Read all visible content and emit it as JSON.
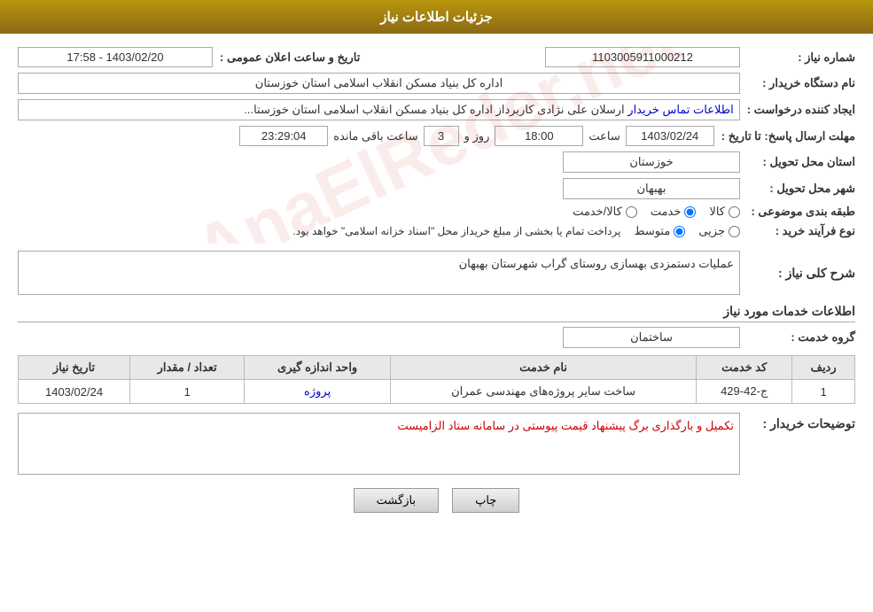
{
  "header": {
    "title": "جزئیات اطلاعات نیاز"
  },
  "fields": {
    "need_number_label": "شماره نیاز :",
    "need_number_value": "1103005911000212",
    "buyer_org_label": "نام دستگاه خریدار :",
    "buyer_org_value": "اداره کل بنیاد مسکن انقلاب اسلامی استان خوزستان",
    "creator_label": "ایجاد کننده درخواست :",
    "creator_value": "ارسلان علی نژادی کاربرداز اداره کل بنیاد مسکن انقلاب اسلامی استان خوزستا...",
    "creator_link": "اطلاعات تماس خریدار",
    "announce_date_label": "تاریخ و ساعت اعلان عمومی :",
    "announce_date_value": "1403/02/20 - 17:58",
    "response_deadline_label": "مهلت ارسال پاسخ: تا تاریخ :",
    "response_date": "1403/02/24",
    "response_time_label": "ساعت",
    "response_time": "18:00",
    "response_days_label": "روز و",
    "response_days": "3",
    "response_remaining_label": "ساعت باقی مانده",
    "response_remaining": "23:29:04",
    "province_label": "استان محل تحویل :",
    "province_value": "خوزستان",
    "city_label": "شهر محل تحویل :",
    "city_value": "بهبهان",
    "category_label": "طبقه بندی موضوعی :",
    "category_options": [
      {
        "label": "کالا",
        "selected": false
      },
      {
        "label": "خدمت",
        "selected": true
      },
      {
        "label": "کالا/خدمت",
        "selected": false
      }
    ],
    "purchase_type_label": "نوع فرآیند خرید :",
    "purchase_type_options": [
      {
        "label": "جزیی",
        "selected": false
      },
      {
        "label": "متوسط",
        "selected": true
      }
    ],
    "purchase_type_desc": "پرداخت تمام یا بخشی از مبلغ خریداز محل \"اسناد خزانه اسلامی\" خواهد بود.",
    "general_desc_label": "شرح کلی نیاز :",
    "general_desc_value": "عملیات دستمزدی بهسازی روستای گراب شهرستان بهبهان",
    "services_section_title": "اطلاعات خدمات مورد نیاز",
    "service_group_label": "گروه خدمت :",
    "service_group_value": "ساختمان",
    "table_headers": {
      "row_num": "ردیف",
      "service_code": "کد خدمت",
      "service_name": "نام خدمت",
      "unit": "واحد اندازه گیری",
      "quantity": "تعداد / مقدار",
      "need_date": "تاریخ نیاز"
    },
    "table_rows": [
      {
        "row_num": "1",
        "service_code": "ج-42-429",
        "service_name": "ساخت سایر پروژه‌های مهندسی عمران",
        "unit": "پروژه",
        "quantity": "1",
        "need_date": "1403/02/24"
      }
    ],
    "buyer_desc_label": "توضیحات خریدار :",
    "buyer_desc_value": "تکمیل و بارگذاری برگ پیشنهاد قیمت پیوستی در سامانه ستاد الزامیست",
    "buttons": {
      "print": "چاپ",
      "back": "بازگشت"
    }
  },
  "watermark_text": "AnaElReder.net"
}
